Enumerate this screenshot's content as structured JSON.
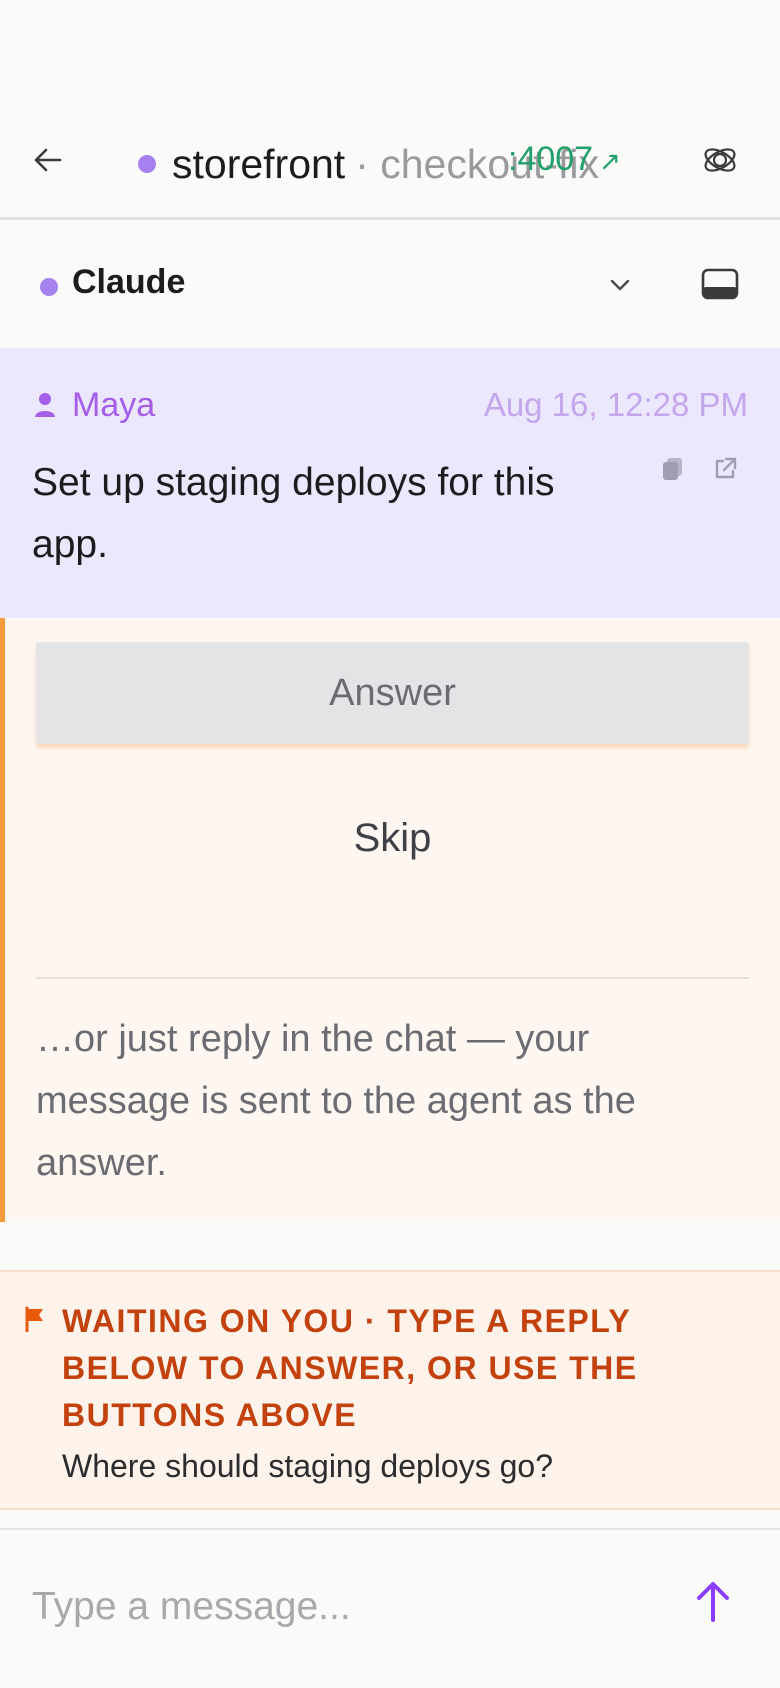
{
  "header": {
    "repo": "storefront",
    "branch": "· checkout-fix",
    "port": ":4007",
    "port_arrow": "↗"
  },
  "agent": {
    "name": "Claude"
  },
  "message": {
    "author": "Maya",
    "time": "Aug 16, 12:28 PM",
    "text": "Set up staging deploys for this app."
  },
  "question": {
    "answer_label": "Answer",
    "skip_label": "Skip",
    "hint": "…or just reply in the chat — your message is sent to the agent as the answer."
  },
  "waiting": {
    "title": "WAITING ON YOU · TYPE A REPLY BELOW TO ANSWER, OR USE THE BUTTONS ABOVE",
    "question": "Where should staging deploys go?"
  },
  "composer": {
    "placeholder": "Type a message..."
  },
  "colors": {
    "accent_purple": "#a682f0",
    "port_green": "#22a06b",
    "warning_orange": "#c2410c",
    "send_purple": "#8b3dff"
  }
}
